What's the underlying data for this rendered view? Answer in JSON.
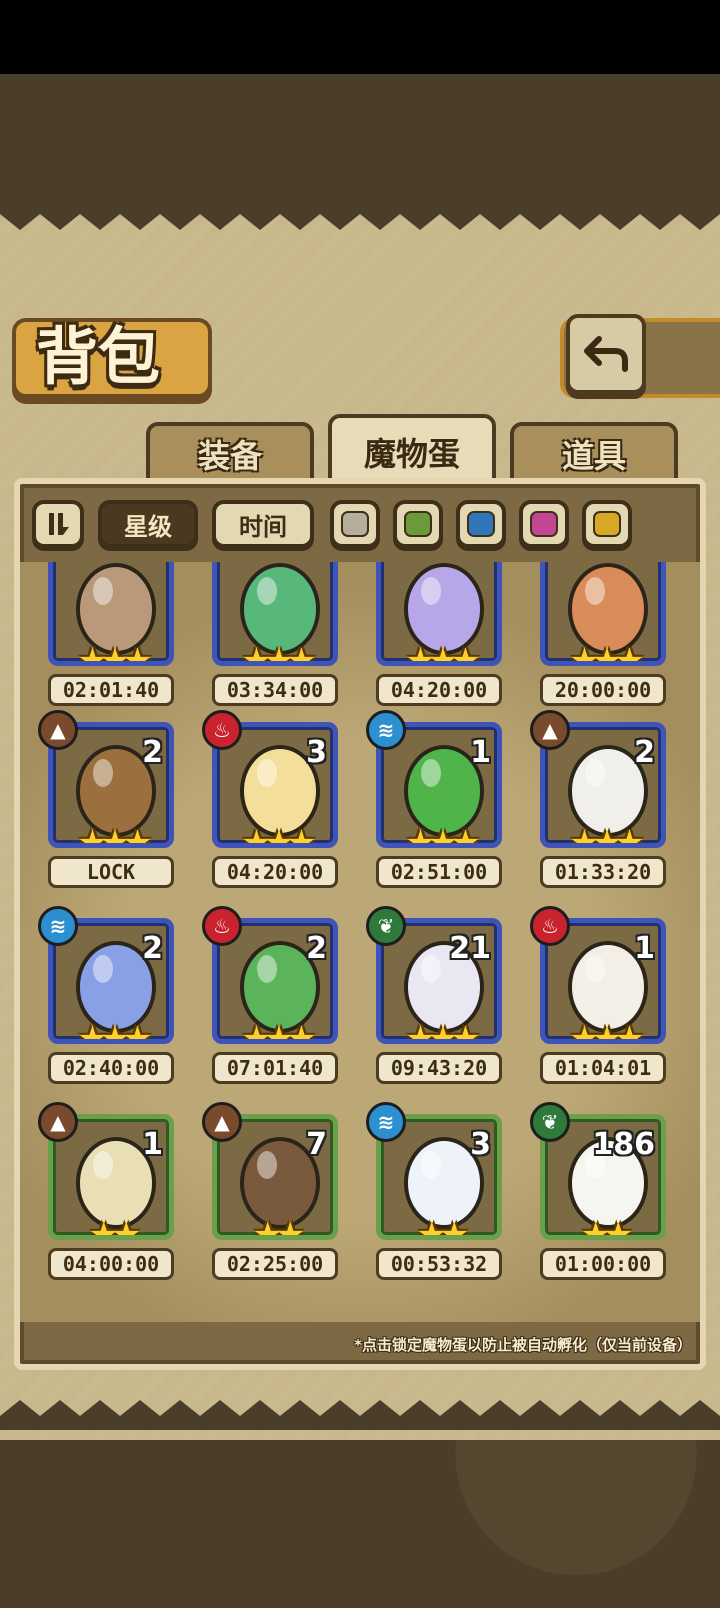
{
  "header": {
    "title": "背包"
  },
  "tabs": [
    {
      "label": "装备",
      "active": false
    },
    {
      "label": "魔物蛋",
      "active": true
    },
    {
      "label": "道具",
      "active": false
    }
  ],
  "filters": {
    "sort_star_label": "星级",
    "sort_time_label": "时间",
    "swatch_colors": [
      "#b6ae9c",
      "#6c9a3b",
      "#2f77b9",
      "#c24691",
      "#d6a826"
    ]
  },
  "rows": [
    [
      {
        "timer": "02:01:40",
        "count": "",
        "stars": "★★★",
        "rarity": "blue",
        "egg": "#b9997a"
      },
      {
        "timer": "03:34:00",
        "count": "",
        "stars": "★★★",
        "rarity": "blue",
        "egg": "#58b77a"
      },
      {
        "timer": "04:20:00",
        "count": "",
        "stars": "★★★",
        "rarity": "blue",
        "egg": "#b7a7e8"
      },
      {
        "timer": "20:00:00",
        "count": "",
        "stars": "★★★",
        "rarity": "blue",
        "egg": "#d98c5a"
      }
    ],
    [
      {
        "element": "earth",
        "count": "2",
        "timer": "LOCK",
        "stars": "★★★",
        "rarity": "blue",
        "egg": "#9b6f3e"
      },
      {
        "element": "fire",
        "count": "3",
        "timer": "04:20:00",
        "stars": "★★★",
        "rarity": "blue",
        "egg": "#f3df9a"
      },
      {
        "element": "water",
        "count": "1",
        "timer": "02:51:00",
        "stars": "★★★",
        "rarity": "blue",
        "egg": "#4fb44a"
      },
      {
        "element": "earth",
        "count": "2",
        "timer": "01:33:20",
        "stars": "★★★",
        "rarity": "blue",
        "egg": "#f1efe9"
      }
    ],
    [
      {
        "element": "water",
        "count": "2",
        "timer": "02:40:00",
        "stars": "★★★",
        "rarity": "blue",
        "egg": "#8aa0e6"
      },
      {
        "element": "fire",
        "count": "2",
        "timer": "07:01:40",
        "stars": "★★★",
        "rarity": "blue",
        "egg": "#5bb35a"
      },
      {
        "element": "leaf",
        "count": "21",
        "timer": "09:43:20",
        "stars": "★★★",
        "rarity": "blue",
        "egg": "#e9e7f2"
      },
      {
        "element": "fire",
        "count": "1",
        "timer": "01:04:01",
        "stars": "★★★",
        "rarity": "blue",
        "egg": "#f4efe6"
      }
    ],
    [
      {
        "element": "earth",
        "count": "1",
        "timer": "04:00:00",
        "stars": "★★",
        "rarity": "green",
        "egg": "#e8e0b4"
      },
      {
        "element": "earth",
        "count": "7",
        "timer": "02:25:00",
        "stars": "★★",
        "rarity": "green",
        "egg": "#7a5a3c"
      },
      {
        "element": "water",
        "count": "3",
        "timer": "00:53:32",
        "stars": "★★",
        "rarity": "green",
        "egg": "#eef3fa"
      },
      {
        "element": "leaf",
        "count": "186",
        "timer": "01:00:00",
        "stars": "★★",
        "rarity": "green",
        "egg": "#f6f6f0"
      }
    ]
  ],
  "footer_hint": "*点击锁定魔物蛋以防止被自动孵化（仅当前设备）"
}
